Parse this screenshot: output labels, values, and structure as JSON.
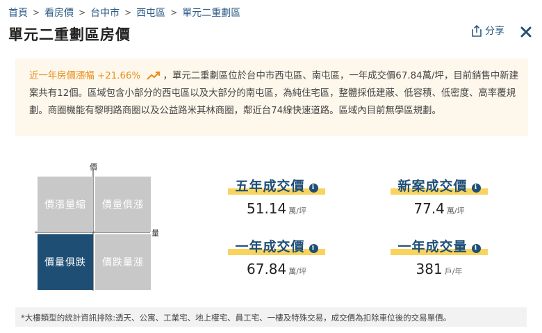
{
  "breadcrumb": {
    "items": [
      "首頁",
      "看房價",
      "台中市",
      "西屯區",
      "單元二重劃區"
    ],
    "separator": ">"
  },
  "header": {
    "title": "單元二重劃區房價",
    "share_label": "分享",
    "close_icon": "close-icon"
  },
  "summary": {
    "trend_label": "近一年房價漲幅",
    "trend_value": "+21.66%",
    "trend_icon": "trending-up-icon",
    "text": "，單元二重劃區位於台中市西屯區、南屯區，一年成交價67.84萬/坪，目前銷售中新建案共有12個。區域包含小部分的西屯區以及大部分的南屯區，為純住宅區，整體採低建蔽、低容積、低密度、高率覆規劃。商圈機能有黎明路商圈以及公益路米其林商圈，鄰近台74線快速道路。區域內目前無學區規劃。"
  },
  "quadrant": {
    "y_axis": "價",
    "x_axis": "量",
    "cells": {
      "top_left": "價漲量縮",
      "top_right": "價量俱漲",
      "bottom_left": "價量俱跌",
      "bottom_right": "價跌量漲"
    },
    "active": "bottom_left"
  },
  "stats": {
    "five_year": {
      "title": "五年成交價",
      "value": "51.14",
      "unit": "萬/坪"
    },
    "new_case": {
      "title": "新案成交價",
      "value": "77.4",
      "unit": "萬/坪"
    },
    "one_year_price": {
      "title": "一年成交價",
      "value": "67.84",
      "unit": "萬/坪"
    },
    "one_year_volume": {
      "title": "一年成交量",
      "value": "381",
      "unit": "戶/年"
    }
  },
  "footnote": "*大樓類型的統計資訊排除:透天、公寓、工業宅、地上權宅、員工宅、一樓及特殊交易，成交價為扣除車位後的交易單價。",
  "colors": {
    "primary": "#1f4f77",
    "accent_orange": "#e8901c",
    "highlight_yellow": "#f8d45f",
    "summary_bg": "#fdf7ec",
    "quad_inactive": "#c8c8c8",
    "quad_active": "#1e4e73"
  }
}
